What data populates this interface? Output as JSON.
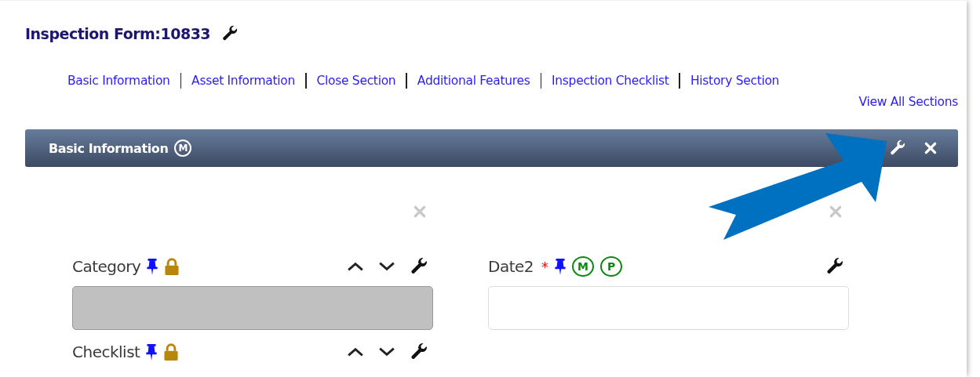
{
  "title": "Inspection Form:10833",
  "nav_links": [
    {
      "label": "Basic Information"
    },
    {
      "label": "Asset Information"
    },
    {
      "label": "Close Section"
    },
    {
      "label": "Additional Features"
    },
    {
      "label": "Inspection Checklist"
    },
    {
      "label": "History Section"
    }
  ],
  "view_all_link": "View All Sections",
  "section": {
    "title": "Basic Information",
    "badge": "M"
  },
  "columns": [
    {
      "fields": [
        {
          "label": "Category",
          "pinned": true,
          "locked": true,
          "movable": true,
          "input": {
            "disabled": true
          }
        },
        {
          "label": "Checklist",
          "pinned": true,
          "locked": true,
          "movable": true
        }
      ]
    },
    {
      "fields": [
        {
          "label": "Date2",
          "required_mark": "*",
          "pinned": true,
          "locked": false,
          "movable": false,
          "badges": [
            "M",
            "P"
          ],
          "input": {
            "disabled": false
          }
        }
      ]
    }
  ]
}
